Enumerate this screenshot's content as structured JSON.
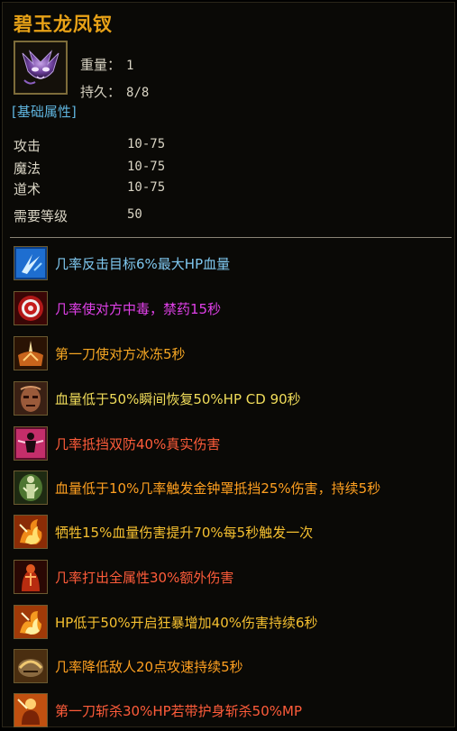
{
  "item": {
    "name": "碧玉龙凤钗",
    "icon": "purple-dragon-hairpin-icon",
    "weight_label": "重量：",
    "weight_value": "1",
    "durability_label": "持久：",
    "durability_value": "8/8"
  },
  "base_section_label": "[基础属性]",
  "base_attrs": [
    {
      "name": "攻击",
      "value": "10-75"
    },
    {
      "name": "魔法",
      "value": "10-75"
    },
    {
      "name": "道术",
      "value": "10-75"
    },
    {
      "name": "需要等级",
      "value": "50"
    }
  ],
  "skills": [
    {
      "icon": "blue-slash-icon",
      "text": "几率反击目标6%最大HP血量",
      "color": "#7fc8f0"
    },
    {
      "icon": "red-target-icon",
      "text": "几率使对方中毒，禁药15秒",
      "color": "#e040e8"
    },
    {
      "icon": "ice-burst-icon",
      "text": "第一刀使对方冰冻5秒",
      "color": "#f5a623"
    },
    {
      "icon": "warrior-face-icon",
      "text": "血量低于50%瞬间恢复50%HP CD 90秒",
      "color": "#f0dc5a"
    },
    {
      "icon": "double-shield-icon",
      "text": "几率抵挡双防40%真实伤害",
      "color": "#ff5c3a"
    },
    {
      "icon": "golden-bell-icon",
      "text": "血量低于10%几率触发金钟罩抵挡25%伤害，持续5秒",
      "color": "#ffa020"
    },
    {
      "icon": "sacrifice-fire-icon",
      "text": "牺牲15%血量伤害提升70%每5秒触发一次",
      "color": "#f5c030"
    },
    {
      "icon": "full-attr-strike-icon",
      "text": "几率打出全属性30%额外伤害",
      "color": "#ff5c3a"
    },
    {
      "icon": "berserk-fire-icon",
      "text": "HP低于50%开启狂暴增加40%伤害持续6秒",
      "color": "#f5c030"
    },
    {
      "icon": "speed-down-icon",
      "text": "几率降低敌人20点攻速持续5秒",
      "color": "#ffa020"
    },
    {
      "icon": "execute-blade-icon",
      "text": "第一刀斩杀30%HP若带护身斩杀50%MP",
      "color": "#ff5c3a"
    }
  ]
}
